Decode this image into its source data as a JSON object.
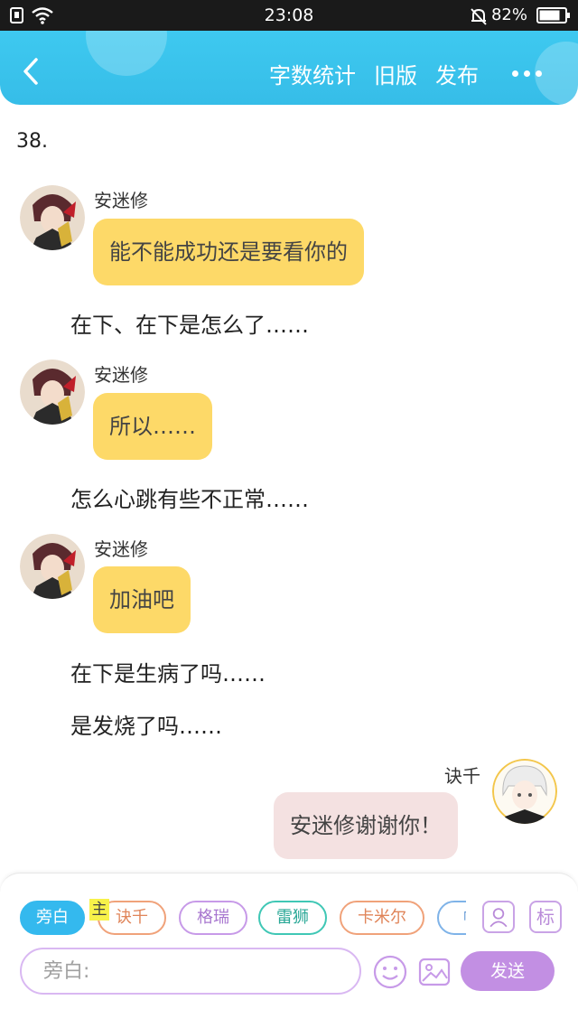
{
  "status_bar": {
    "time": "23:08",
    "battery": "82%"
  },
  "header": {
    "actions": [
      "字数统计",
      "旧版",
      "发布"
    ]
  },
  "chapter": "38.",
  "messages": [
    {
      "speaker": "安迷修",
      "text": "能不能成功还是要看你的"
    },
    {
      "narration": "在下、在下是怎么了……"
    },
    {
      "speaker": "安迷修",
      "text": "所以……"
    },
    {
      "narration": "怎么心跳有些不正常……"
    },
    {
      "speaker": "安迷修",
      "text": "加油吧"
    },
    {
      "narration": "在下是生病了吗……"
    },
    {
      "narration": "是发烧了吗……"
    },
    {
      "speaker": "诀千",
      "text": "安迷修谢谢你！"
    }
  ],
  "composer": {
    "roles": [
      "旁白",
      "诀千",
      "格瑞",
      "雷狮",
      "卡米尔",
      "帕"
    ],
    "role_colors": [
      "#34b9ee",
      "#f0a27a",
      "#c79ae8",
      "#3fc7b5",
      "#f0a27a",
      "#7fb3e8"
    ],
    "main_badge": "主",
    "tag_button": "标",
    "placeholder": "旁白:",
    "send": "发送"
  }
}
